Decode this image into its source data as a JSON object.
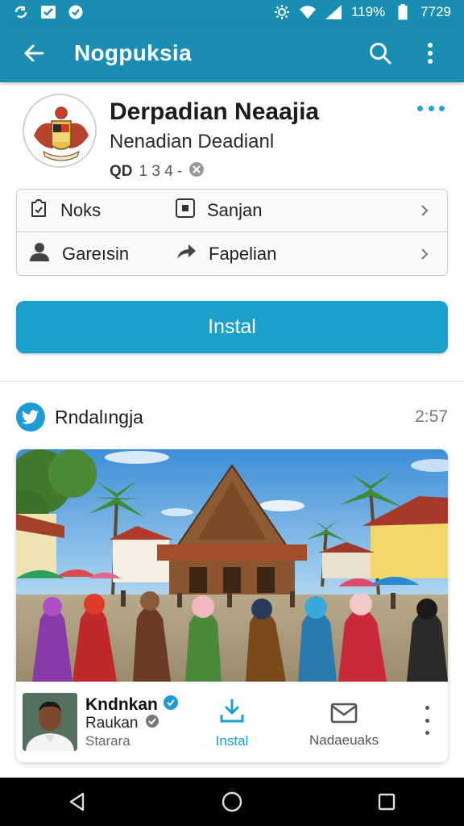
{
  "status_bar": {
    "battery_percent": "119%",
    "time": "7729",
    "icons": [
      "sync-icon",
      "checkbox-icon",
      "chat-icon",
      "brightness-icon",
      "wifi-icon",
      "signal-icon",
      "battery-icon"
    ]
  },
  "app_bar": {
    "title": "Nogpuksia",
    "icons": [
      "back-arrow-icon",
      "search-icon",
      "more-vertical-icon"
    ]
  },
  "profile": {
    "name": "Derpadian Neaajia",
    "subtitle": "Nenadian Deadianl",
    "meta_bold": "QD",
    "meta_count": "1 3 4 -"
  },
  "menu": {
    "rows": [
      {
        "left_label": "Noks",
        "left_icon": "clipboard-icon",
        "right_label": "Sanjan",
        "right_icon": "square-dot-icon"
      },
      {
        "left_label": "Gareısin",
        "left_icon": "person-icon",
        "right_label": "Fapelian",
        "right_icon": "share-arrow-icon"
      }
    ]
  },
  "install_button": {
    "label": "Instal"
  },
  "feed": {
    "title": "Rndalıngja",
    "time": "2:57"
  },
  "post": {
    "author_name": "Kndnkan",
    "author_line2": "Raukan",
    "author_line3": "Starara",
    "action_install": "Instal",
    "action_message": "Nadaeuaks"
  },
  "colors": {
    "primary": "#1a8db3",
    "button": "#1b9fcb",
    "twitter": "#1e9ad6"
  }
}
